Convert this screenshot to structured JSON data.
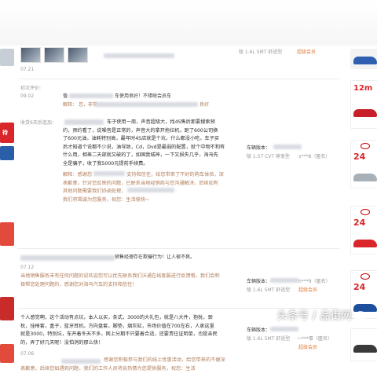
{
  "header": {
    "date_top": "07.21",
    "spec_top": "版 1.6L 5MT 舒适型",
    "member_top": "超级会员"
  },
  "review1": {
    "label_initial": "初次评价:",
    "date1": "09.02",
    "snippet1": "值",
    "snippet1b": "车使用良好！不错啥会员车",
    "label_reply": "解释：",
    "snippet_reply": "您，非常",
    "snippet_reply_end": "良好",
    "label_followup": "收货6天后追加：",
    "body": [
      "车子使用一周，声音超级大，找4S售后那要搜索预",
      "约，预约看了，说噪音是正常的，声音大的拿开拖拉机，跑了600公司换",
      "了600元油，油耗特别高，最年时4S店就是个坑，什么都没小吃，车子买",
      "后才知道个说都不少说，油导致，Cd，Dvd是最弱的配置，就个中物不和有",
      "什么用，相差二天部就又破的了，如国我城神，一下又损失几乎，海马先",
      "全是骗子，收了我5000元提前手续费。"
    ],
    "reply_body": [
      "解释：感谢您",
      "支持和信任，给您带来了不好的购车体验，深",
      "表歉意，针对您反映的问题，已联系当地经销商与您沟通解决，后续如有",
      "其他问题需要我们协调处理，",
      "我们将竭诚为您服务，祝您：生活愉快~"
    ],
    "spec_label": "车辆版本：",
    "spec_value": "版 1.5T CVT 尊享型",
    "user": "x***8（匿名）"
  },
  "review2": {
    "snippet": "销售经理存在欺骗行为！让人很不爽。",
    "date": "07.12",
    "reply": [
      "当地销售服务未有任何问题的说欢迎您可以优先联系我们沃通在线客服进行反馈哦，我们会积",
      "极帮您处理问题的，感谢您对海马汽车的支持和信任！",
      "如，祝您：生活愉快~"
    ],
    "spec_label": "车辆版本：",
    "spec_value": "版 1.6L 5MT 舒适型",
    "user": "h***9（匿名）",
    "member": "超级会员"
  },
  "review3": {
    "body": [
      "个人感觉啊，这个活动有点坑，本人以买，条式，3000的大礼包，就是八大件，抱枕，颈",
      "枕，挂椅套，盒子，蓝牙耳机，方向盘套，脚垫，烟灰缸，市场价值在700左右，人家这里",
      "就是3000，特别坑，车开着冬天不多，网上分期不只要着合适，还要责往证明单，也挺亲民",
      "的，弄了好几天呢！没怕消的那么快！"
    ],
    "date": "07.06",
    "reply": [
      "感谢您积极参与我们的线上优惠活动，给您带来的不便深",
      "表歉意，后续您如遇到问题，我们的工作人员将会热情为您提供服务，祝您：生活"
    ],
    "spec_label": "车辆版本：",
    "spec_value": "版 1.6L 5MT 舒适型",
    "user": "一***事（匿名）",
    "member": "超级会员"
  },
  "right_ads": [
    {
      "text": "12m"
    },
    {
      "text": "24"
    },
    {
      "text": "24"
    },
    {
      "text": "24"
    }
  ],
  "left_ads": [
    {
      "text": "待"
    }
  ],
  "watermark": "头条号 / 品街网",
  "colors": {
    "accent": "#e17a3a",
    "ad_red": "#d8262a",
    "ad_blue": "#1d4f9c"
  }
}
